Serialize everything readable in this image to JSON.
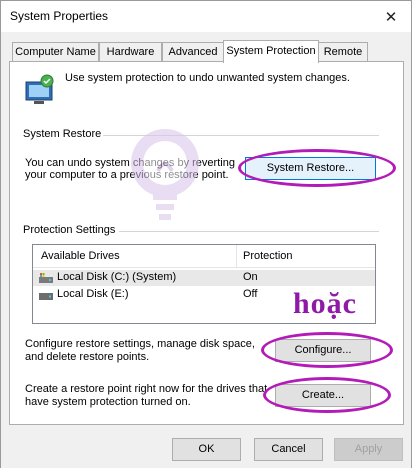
{
  "window": {
    "title": "System Properties"
  },
  "tabs": [
    {
      "label": "Computer Name",
      "active": false
    },
    {
      "label": "Hardware",
      "active": false
    },
    {
      "label": "Advanced",
      "active": false
    },
    {
      "label": "System Protection",
      "active": true
    },
    {
      "label": "Remote",
      "active": false
    }
  ],
  "intro": "Use system protection to undo unwanted system changes.",
  "system_restore": {
    "group_label": "System Restore",
    "text_line1": "You can undo system changes by reverting",
    "text_line2": "your computer to a previous restore point.",
    "button_label": "System Restore..."
  },
  "protection": {
    "group_label": "Protection Settings",
    "columns": [
      "Available Drives",
      "Protection"
    ],
    "drives": [
      {
        "name": "Local Disk (C:) (System)",
        "protection": "On",
        "selected": true
      },
      {
        "name": "Local Disk (E:)",
        "protection": "Off",
        "selected": false
      }
    ]
  },
  "configure": {
    "text_line1": "Configure restore settings, manage disk space,",
    "text_line2": "and delete restore points.",
    "button_label": "Configure..."
  },
  "create": {
    "text_line1": "Create a restore point right now for the drives that",
    "text_line2": "have system protection turned on.",
    "button_label": "Create..."
  },
  "footer": {
    "ok_label": "OK",
    "cancel_label": "Cancel",
    "apply_label": "Apply"
  },
  "overlay": {
    "annotation": "hoặc",
    "highlight_color": "#b31bb8"
  },
  "icons": {
    "close": "close-icon",
    "shield": "computer-shield-icon",
    "system_drive": "system-drive-icon",
    "drive": "drive-icon",
    "watermark": "lightbulb-watermark-icon"
  }
}
